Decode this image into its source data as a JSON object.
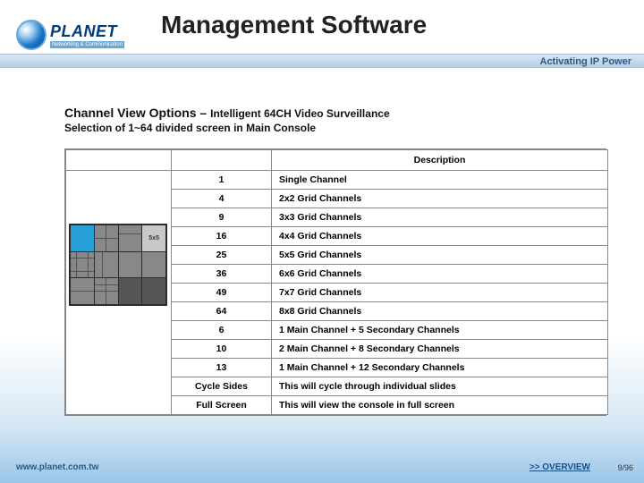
{
  "logo": {
    "name": "PLANET",
    "tagline": "Networking & Communication"
  },
  "title": "Management Software",
  "ribbon": "Activating IP Power",
  "section": {
    "lead": "Channel View Options – ",
    "lead_sub": "Intelligent 64CH Video Surveillance",
    "line2": "Selection of 1~64 divided screen in Main Console"
  },
  "table": {
    "header_desc": "Description",
    "thumb_label": "5x5",
    "rows": [
      {
        "k": "1",
        "d": "Single Channel"
      },
      {
        "k": "4",
        "d": "2x2 Grid Channels"
      },
      {
        "k": "9",
        "d": "3x3 Grid Channels"
      },
      {
        "k": "16",
        "d": "4x4 Grid Channels"
      },
      {
        "k": "25",
        "d": "5x5 Grid Channels"
      },
      {
        "k": "36",
        "d": "6x6 Grid Channels"
      },
      {
        "k": "49",
        "d": "7x7 Grid Channels"
      },
      {
        "k": "64",
        "d": "8x8 Grid Channels"
      },
      {
        "k": "6",
        "d": "1 Main Channel + 5 Secondary Channels"
      },
      {
        "k": "10",
        "d": "2 Main Channel + 8 Secondary Channels"
      },
      {
        "k": "13",
        "d": "1 Main Channel + 12 Secondary Channels"
      },
      {
        "k": "Cycle Sides",
        "d": "This will cycle through individual slides"
      },
      {
        "k": "Full Screen",
        "d": "This will view the console in full screen"
      }
    ]
  },
  "footer": {
    "url": "www.planet.com.tw",
    "overview": ">> OVERVIEW",
    "page": "9/96"
  }
}
